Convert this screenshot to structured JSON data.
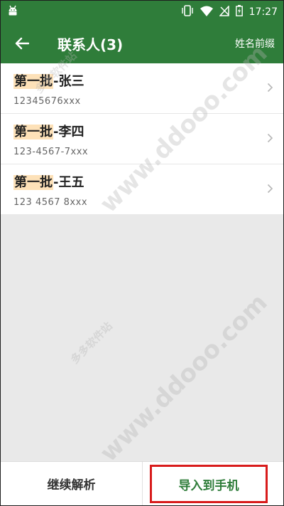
{
  "status_bar": {
    "time": "17:27"
  },
  "app_bar": {
    "title": "联系人(3)",
    "action_label": "姓名前缀"
  },
  "contacts": [
    {
      "prefix": "第一批",
      "name": "-张三",
      "phone": "12345676xxx"
    },
    {
      "prefix": "第一批",
      "name": "-李四",
      "phone": "123-4567-7xxx"
    },
    {
      "prefix": "第一批",
      "name": "-王五",
      "phone": "123 4567 8xxx"
    }
  ],
  "bottom_bar": {
    "continue_label": "继续解析",
    "import_label": "导入到手机"
  },
  "watermarks": [
    "www.ddooo.com",
    "多多软件站",
    "www.ddooo.com",
    "多多软件站"
  ],
  "colors": {
    "primary_green": "#2f7d3a",
    "highlight": "#fde1b8",
    "emphasis_border": "#d81c1c"
  }
}
